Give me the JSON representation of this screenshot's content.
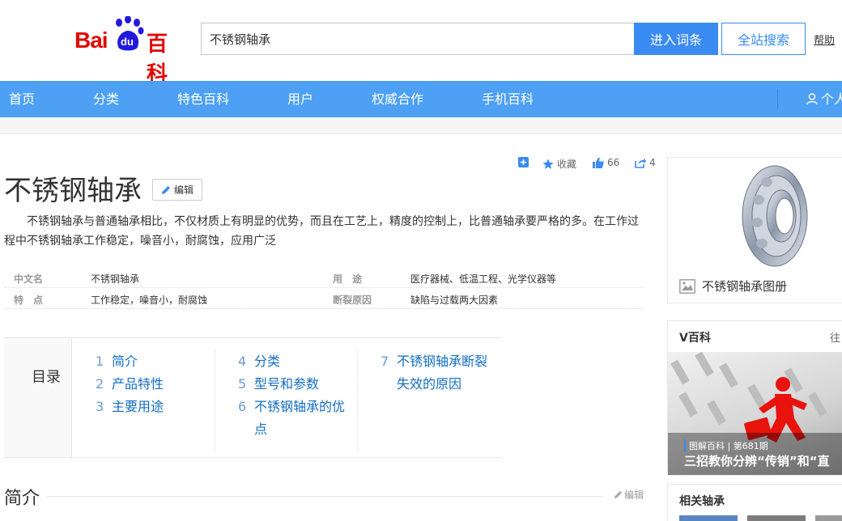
{
  "search": {
    "value": "不锈钢轴承",
    "enter_label": "进入词条",
    "site_label": "全站搜索",
    "help_label": "帮助"
  },
  "logo": {
    "bai": "Bai",
    "du": "du",
    "baike": "百科"
  },
  "nav": {
    "items": [
      "首页",
      "分类",
      "特色百科",
      "用户",
      "权威合作",
      "手机百科"
    ],
    "user_label": "个人"
  },
  "toolbar": {
    "collect_label": "收藏",
    "like_count": "66",
    "share_count": "4"
  },
  "entry": {
    "title": "不锈钢轴承",
    "edit_label": "编辑",
    "summary": "不锈钢轴承与普通轴承相比，不仅材质上有明显的优势，而且在工艺上，精度的控制上，比普通轴承要严格的多。在工作过程中不锈钢轴承工作稳定，噪音小，耐腐蚀，应用广泛"
  },
  "basic_info": [
    {
      "name_left": "中文名",
      "val_left": "不锈钢轴承",
      "name_right": "用　途",
      "val_right": "医疗器械、低温工程、光学仪器等"
    },
    {
      "name_left": "特　点",
      "val_left": "工作稳定，噪音小，耐腐蚀",
      "name_right": "断裂原因",
      "val_right": "缺陷与过载两大因素"
    }
  ],
  "toc": {
    "label": "目录",
    "items": [
      {
        "num": "1",
        "text": "简介"
      },
      {
        "num": "2",
        "text": "产品特性"
      },
      {
        "num": "3",
        "text": "主要用途"
      },
      {
        "num": "4",
        "text": "分类"
      },
      {
        "num": "5",
        "text": "型号和参数"
      },
      {
        "num": "6",
        "text_line1": "不锈钢轴承的优",
        "text_line2": "点"
      },
      {
        "num": "7",
        "text_line1": "不锈钢轴承断裂",
        "text_line2": "失效的原因"
      }
    ]
  },
  "section": {
    "title": "简介",
    "edit_label": "编辑"
  },
  "side": {
    "album_caption": "不锈钢轴承图册",
    "v_title": "V百科",
    "v_more": "往",
    "v_cap_small": "图解百科 | 第681期",
    "v_cap_big": "三招教你分辨“传销”和“直",
    "related_title": "相关轴承"
  },
  "colors": {
    "brand_blue": "#3a8bf2",
    "nav_blue": "#4da0f3",
    "logo_red": "#e10601",
    "link_blue": "#136ec2"
  }
}
